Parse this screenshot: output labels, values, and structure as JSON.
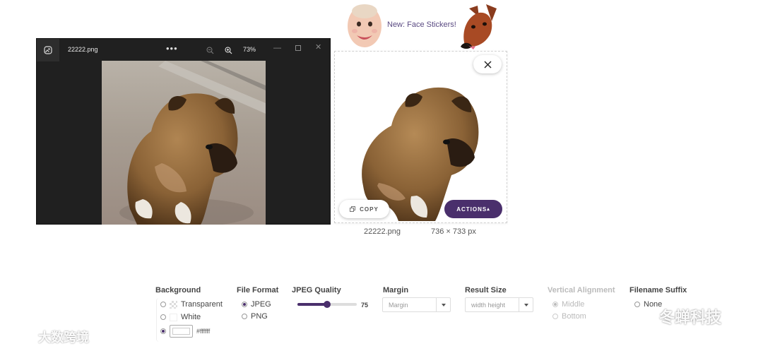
{
  "viewer": {
    "filename": "22222.png",
    "more_label": "•••",
    "zoom_level": "73%",
    "min_label": "—",
    "close_label": "✕"
  },
  "banner": {
    "text": "New: Face Stickers!"
  },
  "result": {
    "copy_label": "COPY",
    "actions_label": "ACTIONS",
    "actions_caret": "▴",
    "filename": "22222.png",
    "dimensions": "736 × 733 px"
  },
  "settings": {
    "background": {
      "title": "Background",
      "options": [
        "Transparent",
        "White"
      ],
      "selected": "custom",
      "custom_color": "#ffffff"
    },
    "file_format": {
      "title": "File Format",
      "options": [
        "JPEG",
        "PNG"
      ],
      "selected": "JPEG"
    },
    "jpeg_quality": {
      "title": "JPEG Quality",
      "value": "75",
      "fraction": 0.5
    },
    "margin": {
      "title": "Margin",
      "placeholder": "Margin"
    },
    "result_size": {
      "title": "Result Size",
      "value": "width height"
    },
    "vertical_alignment": {
      "title": "Vertical Alignment",
      "options": [
        "Middle",
        "Bottom"
      ],
      "selected": "Middle",
      "disabled": true
    },
    "filename_suffix": {
      "title": "Filename Suffix",
      "options": [
        "None"
      ],
      "selected": "None"
    }
  },
  "watermarks": {
    "left": "大数跨境",
    "right": "冬蝉科技"
  },
  "colors": {
    "accent": "#4a2f6c",
    "banner_text": "#5a4a82",
    "viewer_bg": "#202020"
  }
}
